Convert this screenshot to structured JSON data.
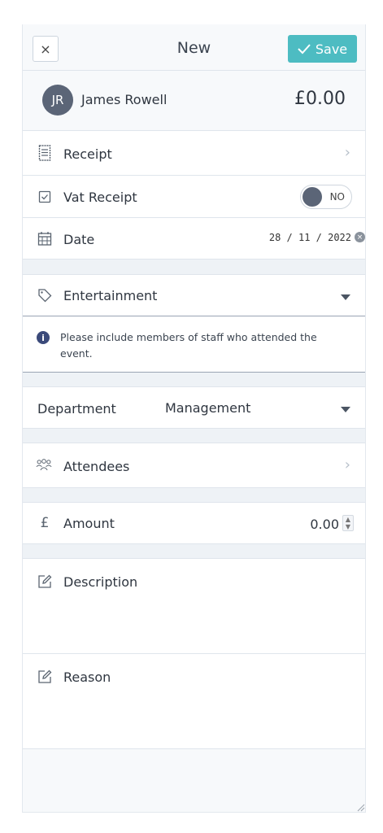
{
  "header": {
    "close_label": "×",
    "title": "New",
    "save_label": "Save"
  },
  "user": {
    "initials": "JR",
    "name": "James Rowell",
    "total": "£0.00"
  },
  "receipt": {
    "label": "Receipt"
  },
  "vat_receipt": {
    "label": "Vat Receipt",
    "toggle_text": "NO"
  },
  "date": {
    "label": "Date",
    "value": "28 / 11 / 2022"
  },
  "category": {
    "label": "Entertainment"
  },
  "info": {
    "text": "Please include members of staff who attended the event."
  },
  "department": {
    "label": "Department",
    "value": "Management"
  },
  "attendees": {
    "label": "Attendees"
  },
  "amount": {
    "label": "Amount",
    "value": "0.00"
  },
  "description": {
    "label": "Description"
  },
  "reason": {
    "label": "Reason"
  },
  "colors": {
    "accent": "#4dbcc2",
    "avatar": "#5b6577",
    "info": "#3b4a7a"
  }
}
